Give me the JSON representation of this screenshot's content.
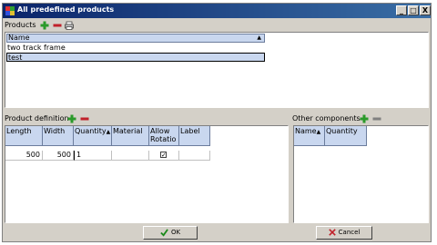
{
  "window": {
    "title": "All predefined products"
  },
  "titlebar_buttons": {
    "minimize": "_",
    "maximize": "□",
    "close": "X"
  },
  "products": {
    "label": "Products",
    "column_header": "Name",
    "items": [
      {
        "name": "two track frame",
        "selected": false
      },
      {
        "name": "test",
        "selected": true
      }
    ]
  },
  "product_definition": {
    "label": "Product definition",
    "columns": [
      "Length",
      "Width",
      "Quantity",
      "Material",
      "Allow Rotatio",
      "Label"
    ],
    "rows": [
      {
        "length": "500",
        "width": "500",
        "quantity": "1",
        "material": "",
        "allow_rotation": "✓",
        "label": ""
      }
    ]
  },
  "other_components": {
    "label": "Other components",
    "columns": [
      "Name",
      "Quantity"
    ]
  },
  "footer": {
    "ok_label": "OK",
    "cancel_label": "Cancel"
  },
  "icons": {
    "add": "plus-icon",
    "remove": "minus-icon",
    "print": "print-icon",
    "ok": "check-icon",
    "cancel": "x-icon"
  },
  "colors": {
    "titlebar_start": "#0a246a",
    "titlebar_end": "#3a6ea5",
    "header_bg": "#c9d7ef",
    "add_green": "#2a9a2a",
    "remove_red": "#c0202a"
  }
}
